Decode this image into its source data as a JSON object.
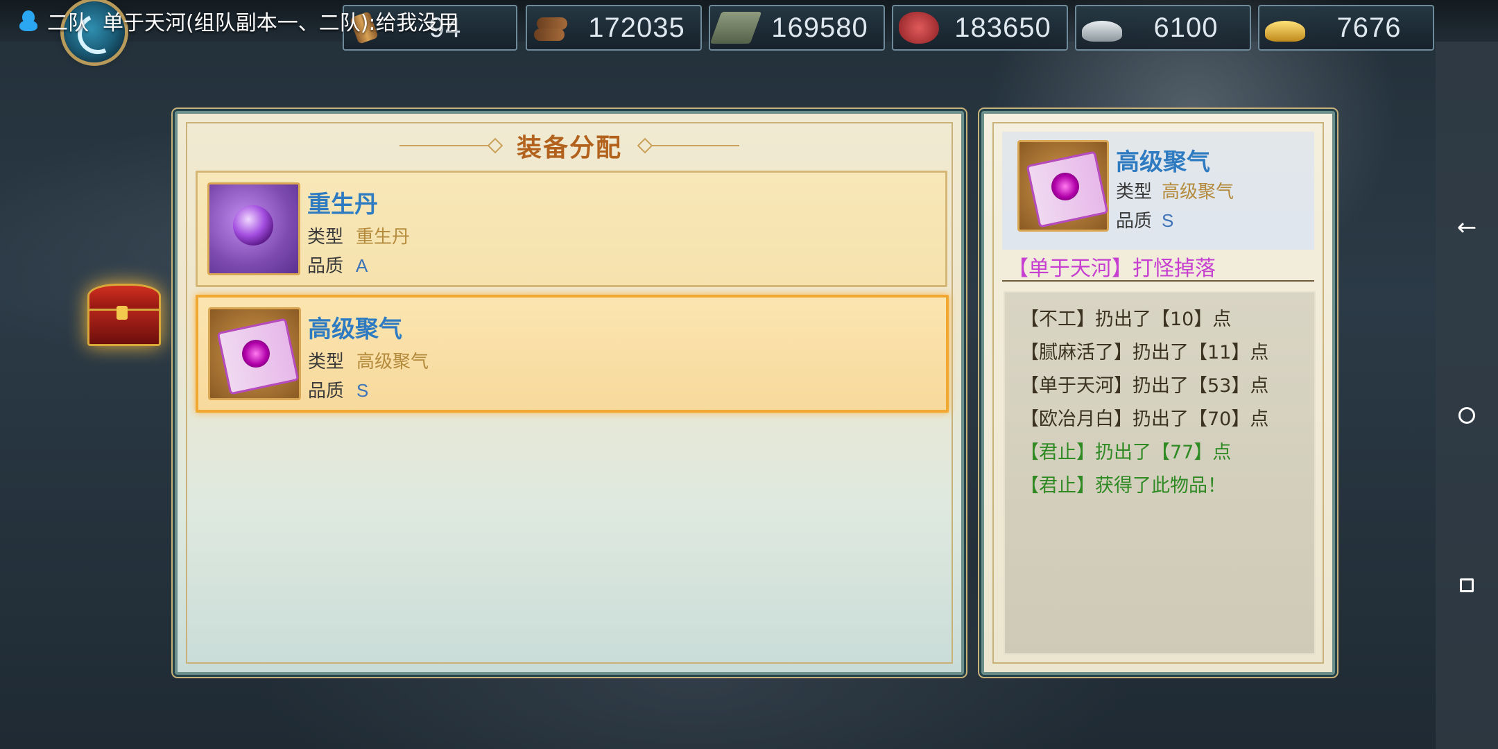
{
  "chat": {
    "team": "二队",
    "message": "单于天河(组队副本一、二队):给我没用"
  },
  "resources": [
    {
      "icon": "scroll-icon",
      "value": "94"
    },
    {
      "icon": "wood-icon",
      "value": "172035"
    },
    {
      "icon": "stone-icon",
      "value": "169580"
    },
    {
      "icon": "meat-icon",
      "value": "183650"
    },
    {
      "icon": "silver-ingot-icon",
      "value": "6100"
    },
    {
      "icon": "gold-ingot-icon",
      "value": "7676"
    }
  ],
  "allocation": {
    "title": "装备分配",
    "items": [
      {
        "name": "重生丹",
        "type_label": "类型",
        "type_value": "重生丹",
        "quality_label": "品质",
        "quality_value": "A",
        "icon": "pill-icon",
        "selected": false
      },
      {
        "name": "高级聚气",
        "type_label": "类型",
        "type_value": "高级聚气",
        "quality_label": "品质",
        "quality_value": "S",
        "icon": "scroll-icon",
        "selected": true
      }
    ]
  },
  "detail": {
    "name": "高级聚气",
    "type_label": "类型",
    "type_value": "高级聚气",
    "quality_label": "品质",
    "quality_value": "S",
    "drop_source": "【单于天河】打怪掉落",
    "log": [
      {
        "text": "【不工】扔出了【10】点",
        "color": "dark"
      },
      {
        "text": "【腻麻活了】扔出了【11】点",
        "color": "dark"
      },
      {
        "text": "【单于天河】扔出了【53】点",
        "color": "dark"
      },
      {
        "text": "【欧冶月白】扔出了【70】点",
        "color": "dark"
      },
      {
        "text": "【君止】扔出了【77】点",
        "color": "green"
      },
      {
        "text": "【君止】获得了此物品！",
        "color": "green"
      }
    ]
  },
  "nav": {
    "back": "←"
  },
  "colors": {
    "accent_title": "#b2621d",
    "item_name": "#2f7bc2",
    "drop_title": "#c63fd1",
    "winner": "#2f8a24"
  }
}
